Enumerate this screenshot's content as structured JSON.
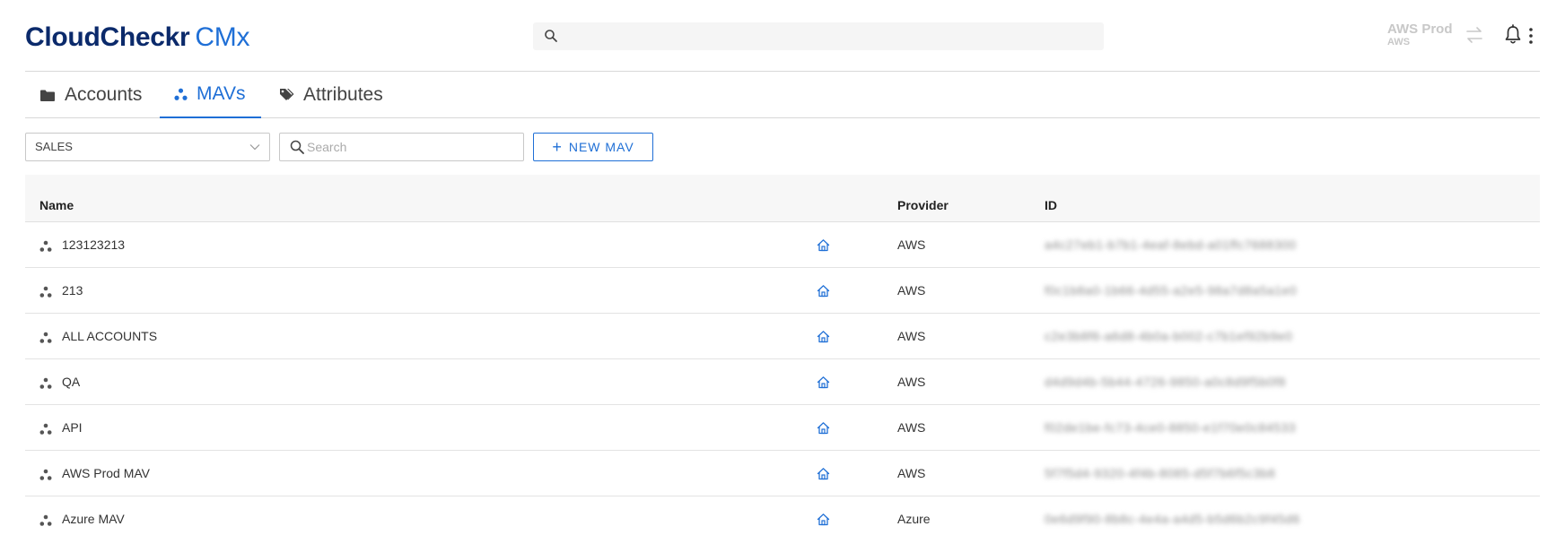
{
  "header": {
    "logo_brand": "CloudCheckr",
    "logo_product": "CMx",
    "account_name": "AWS Prod",
    "account_provider": "AWS"
  },
  "tabs": [
    {
      "label": "Accounts",
      "icon": "folder-icon"
    },
    {
      "label": "MAVs",
      "icon": "mav-icon",
      "active": true
    },
    {
      "label": "Attributes",
      "icon": "tags-icon"
    }
  ],
  "toolbar": {
    "select_value": "SALES",
    "search_placeholder": "Search",
    "new_label": "NEW MAV"
  },
  "table": {
    "columns": [
      "Name",
      "Provider",
      "ID"
    ],
    "rows": [
      {
        "name": "123123213",
        "provider": "AWS",
        "id": "a4c27eb1-b7b1-4eaf-8ebd-a01ffc7688300"
      },
      {
        "name": "213",
        "provider": "AWS",
        "id": "f0c1b8a0-1b66-4d55-a2e5-98a7d8a5a1e0"
      },
      {
        "name": "ALL ACCOUNTS",
        "provider": "AWS",
        "id": "c2e3b8f6-a6d8-4b0a-b002-c7b1ef92b9e0"
      },
      {
        "name": "QA",
        "provider": "AWS",
        "id": "d4d9d4b-5b44-4726-9850-a0c8d9f5b0f8"
      },
      {
        "name": "API",
        "provider": "AWS",
        "id": "f02de1be-fc73-4ce0-8850-e1f70e0c84533"
      },
      {
        "name": "AWS Prod MAV",
        "provider": "AWS",
        "id": "5f7f5d4-9320-4f4b-8085-d5f7b6f5c3b8"
      },
      {
        "name": "Azure MAV",
        "provider": "Azure",
        "id": "0e6d9f90-8b8c-4e4a-a4d5-b5d6b2c9f45d6"
      }
    ]
  },
  "colors": {
    "accent": "#1f6fd6",
    "brand": "#0b2a6b"
  }
}
